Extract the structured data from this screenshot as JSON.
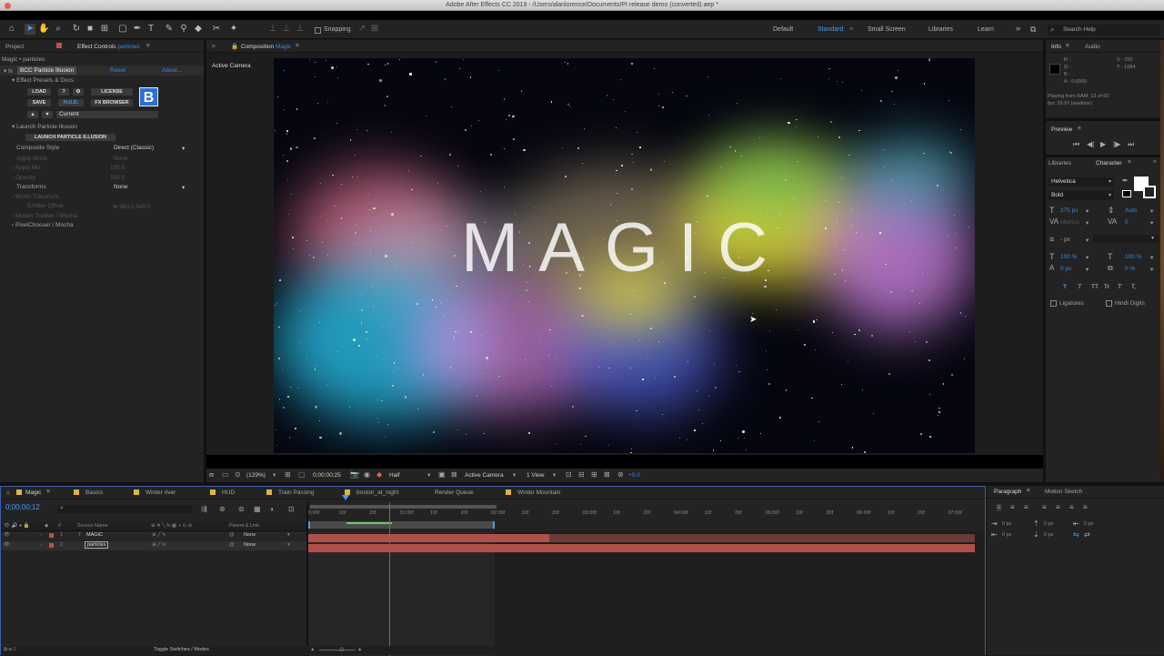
{
  "window": {
    "title": "Adobe After Effects CC 2019 - /Users/alanlorence/Documents/PI release demo (converted).aep *"
  },
  "toolbar": {
    "snapping": "Snapping",
    "workspaces": [
      "Default",
      "Standard",
      "Small Screen",
      "Libraries",
      "Learn"
    ],
    "active_workspace": "Standard",
    "search_placeholder": "Search Help"
  },
  "project_panel": {
    "tab_project": "Project",
    "tab_effect_controls": "Effect Controls",
    "effect_target": "particles"
  },
  "effect_controls": {
    "layer_path": "Magic • particles",
    "effect_name": "BCC Particle Illusion",
    "reset": "Reset",
    "about": "About...",
    "presets_group": "Effect Presets & Docs",
    "btn_load": "LOAD",
    "btn_help": "?",
    "btn_license": "LICENSE",
    "btn_save": "SAVE",
    "btn_hud": "H.U.D.",
    "btn_fx_browser": "FX BROWSER",
    "logo": "B",
    "current": "Current",
    "launch_group": "Launch Particle Illusion",
    "btn_launch": "LAUNCH PARTICLE ILLUSION",
    "composite_style_label": "Composite Style",
    "composite_style_value": "Direct (Classic)",
    "apply_mode_label": "Apply Mode",
    "apply_mode_value": "None",
    "apply_mix_label": "Apply Mix",
    "apply_mix_value": "100.0",
    "opacity_label": "Opacity",
    "opacity_value": "100.0",
    "transforms_label": "Transforms",
    "transforms_value": "None",
    "world_transform_label": "World Transform",
    "emitter_offset_label": "Emitter Offset",
    "emitter_offset_value": "960.0,540.0",
    "motion_tracker_label": "Motion Tracker / Mocha",
    "pixelchooser_label": "PixelChooser / Mocha"
  },
  "composition": {
    "tab_label": "Composition",
    "comp_name": "Magic",
    "camera_label": "Active Camera",
    "canvas_text": "MAGIC",
    "zoom": "(129%)",
    "timecode": "0;00;00;25",
    "resolution": "Half",
    "camera_select": "Active Camera",
    "views": "1 View",
    "exposure": "+0.0"
  },
  "info_panel": {
    "tab_info": "Info",
    "tab_audio": "Audio",
    "r": "R :",
    "g": "G :",
    "b": "B :",
    "a": "A : 0.0000",
    "x": "X : 250",
    "y": "Y : 1084",
    "playing": "Playing from RAM: 13 of 60",
    "fps": "fps: 29.97 (realtime)"
  },
  "preview_panel": {
    "title": "Preview"
  },
  "character_panel": {
    "tab_libraries": "Libraries",
    "tab_character": "Character",
    "font": "Helvetica",
    "style": "Bold",
    "size": "275 px",
    "leading": "Auto",
    "kerning": "Metrics",
    "tracking": "0",
    "stroke_unit": "- px",
    "v_scale": "100 %",
    "h_scale": "100 %",
    "baseline": "0 px",
    "tsume": "0 %",
    "ligatures": "Ligatures",
    "hindi_digits": "Hindi Digits",
    "type_styles": [
      "T",
      "T",
      "TT",
      "Tr",
      "T'",
      "T,"
    ]
  },
  "timeline": {
    "tabs": [
      "Magic",
      "Basics",
      "Winter river",
      "HUD",
      "Train Passing",
      "boston_at_night",
      "Render Queue",
      "Winter Mountain"
    ],
    "current_time": "0;00;00;12",
    "columns": {
      "source_name": "Source Name",
      "parent": "Parent & Link"
    },
    "layers": [
      {
        "num": "1",
        "type": "T",
        "name": "MAGIC",
        "parent": "None",
        "color": "#c0504d"
      },
      {
        "num": "2",
        "type": "",
        "name": "particles",
        "parent": "None",
        "color": "#c0504d"
      }
    ],
    "ruler": [
      "0;00f",
      "10f",
      "20f",
      "01:00f",
      "10f",
      "20f",
      "02:00f",
      "10f",
      "20f",
      "03:00f",
      "10f",
      "20f",
      "04:00f",
      "10f",
      "20f",
      "05:00f",
      "10f",
      "20f",
      "06:00f",
      "10f",
      "20f",
      "07:00f"
    ],
    "toggle": "Toggle Switches / Modes"
  },
  "paragraph_panel": {
    "tab_paragraph": "Paragraph",
    "tab_motion_sketch": "Motion Sketch",
    "indent_left": "0 px",
    "indent_first": "0 px",
    "indent_right": "0 px",
    "space_before": "0 px",
    "space_after": "0 px"
  }
}
